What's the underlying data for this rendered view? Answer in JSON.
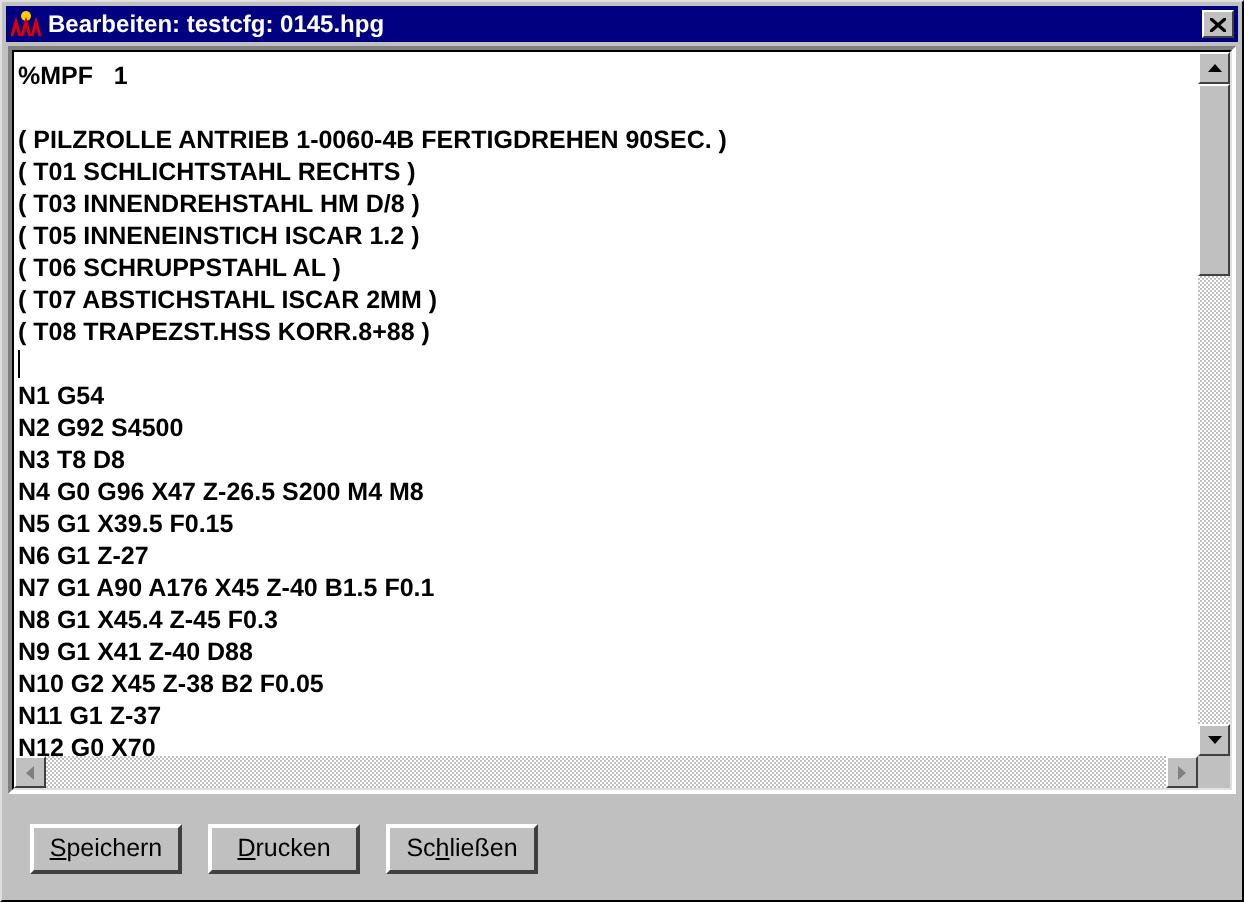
{
  "window": {
    "title": "Bearbeiten: testcfg: 0145.hpg"
  },
  "editor": {
    "lines": [
      {
        "kind": "text",
        "text": "%MPF   1"
      },
      {
        "kind": "blank"
      },
      {
        "kind": "text",
        "text": "( PILZROLLE ANTRIEB 1-0060-4B FERTIGDREHEN 90SEC. )"
      },
      {
        "kind": "text",
        "text": "( T01 SCHLICHTSTAHL RECHTS )"
      },
      {
        "kind": "text",
        "text": "( T03 INNENDREHSTAHL HM D/8 )"
      },
      {
        "kind": "text",
        "text": "( T05 INNENEINSTICH ISCAR 1.2 )"
      },
      {
        "kind": "text",
        "text": "( T06 SCHRUPPSTAHL AL )"
      },
      {
        "kind": "text",
        "text": "( T07 ABSTICHSTAHL ISCAR 2MM )"
      },
      {
        "kind": "text",
        "text": "( T08 TRAPEZST.HSS KORR.8+88 )"
      },
      {
        "kind": "cursor"
      },
      {
        "kind": "text",
        "text": "N1 G54"
      },
      {
        "kind": "text",
        "text": "N2 G92 S4500"
      },
      {
        "kind": "text",
        "text": "N3 T8 D8"
      },
      {
        "kind": "text",
        "text": "N4 G0 G96 X47 Z-26.5 S200 M4 M8"
      },
      {
        "kind": "text",
        "text": "N5 G1 X39.5 F0.15"
      },
      {
        "kind": "text",
        "text": "N6 G1 Z-27"
      },
      {
        "kind": "text",
        "text": "N7 G1 A90 A176 X45 Z-40 B1.5 F0.1"
      },
      {
        "kind": "text",
        "text": "N8 G1 X45.4 Z-45 F0.3"
      },
      {
        "kind": "text",
        "text": "N9 G1 X41 Z-40 D88"
      },
      {
        "kind": "text",
        "text": "N10 G2 X45 Z-38 B2 F0.05"
      },
      {
        "kind": "text",
        "text": "N11 G1 Z-37"
      },
      {
        "kind": "text",
        "text": "N12 G0 X70"
      }
    ]
  },
  "buttons": [
    {
      "key": "S",
      "after": "peichern"
    },
    {
      "key": "D",
      "after": "rucken"
    },
    {
      "before": "Sc",
      "key": "h",
      "after": "ließen"
    }
  ]
}
